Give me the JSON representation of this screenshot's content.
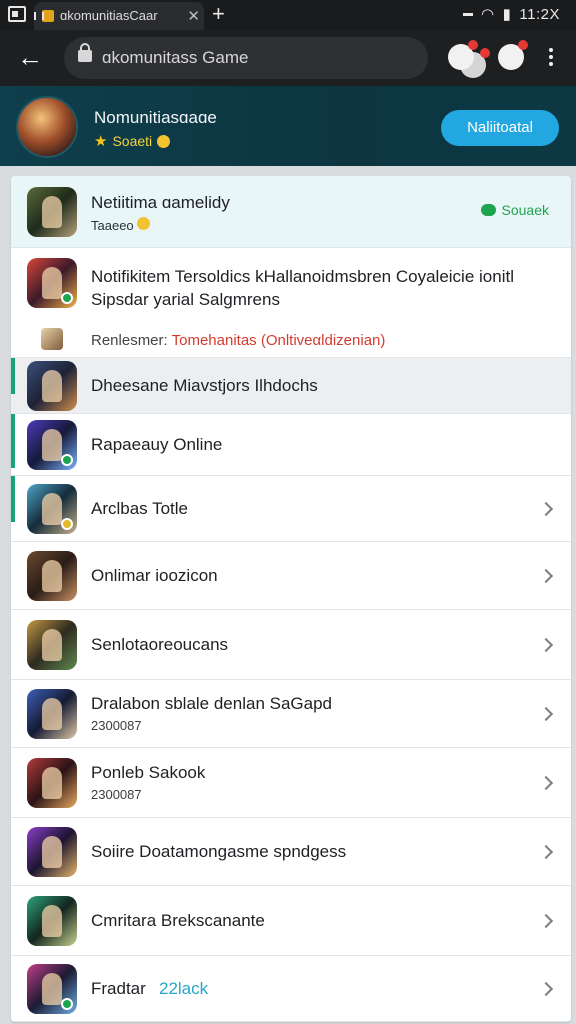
{
  "status_bar": {
    "tab_title": "ɑkomunitiasCaar",
    "tab_close": "✕",
    "tab_new": "+",
    "time": "11:2X"
  },
  "toolbar": {
    "url": "ɑkomunitass Game"
  },
  "banner": {
    "title": "Nomunitiasɑaɑe",
    "subtitle": "Soaeti",
    "button_label": "Naliitoatal"
  },
  "top_item": {
    "title": "Netiitima ɑamelidy",
    "subtitle": "Taaeeo",
    "status": "Souaek"
  },
  "notice": {
    "line1": "Notifikitem Tersoldics kHallanoidmsbren Coyaleicie ionitl",
    "line2": "Sipsdar yarial Salgmrens",
    "mini_label": "Renlesmer:",
    "mini_link": "Tomehanitas (Onltiveαldizenian)"
  },
  "items": [
    {
      "title": "Dheesane Miavstjors Ilhdochs",
      "subtitle": ""
    },
    {
      "title": "Rapaeauy Online",
      "subtitle": ""
    },
    {
      "title": "Arclbas Totle",
      "subtitle": ""
    },
    {
      "title": "Onlimar ioozicon",
      "subtitle": ""
    },
    {
      "title": "Senlotaoreoucans",
      "subtitle": ""
    },
    {
      "title": "Dralabon sblale denlan SaGapd",
      "subtitle": "2300087"
    },
    {
      "title": "Ponleb Sakook",
      "subtitle": "2300087"
    },
    {
      "title": "Soiire Doatamongasme spndgess",
      "subtitle": ""
    },
    {
      "title": "Cmritara Brekscanante",
      "subtitle": ""
    },
    {
      "title": "Fradtar",
      "subtitle": "",
      "tag": "22lack"
    }
  ],
  "colors": {
    "accent": "#19a37a",
    "banner_bg": "#0c3540",
    "primary_button": "#22a7e0",
    "link_red": "#d43b2f"
  }
}
